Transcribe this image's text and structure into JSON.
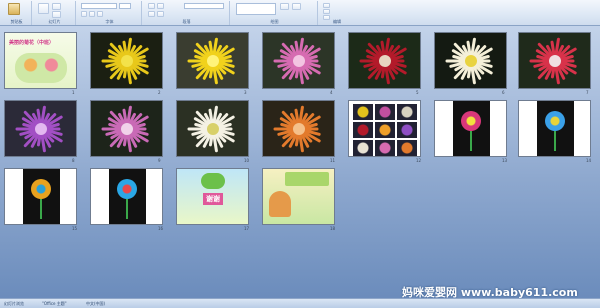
{
  "ribbon": {
    "groups": [
      {
        "label": "剪贴板"
      },
      {
        "label": "幻灯片"
      },
      {
        "label": "字体"
      },
      {
        "label": "段落"
      },
      {
        "label": "绘图"
      },
      {
        "label": "编辑"
      }
    ]
  },
  "slides": [
    {
      "num": "1",
      "kind": "title",
      "title": "美丽的菊花（中班）"
    },
    {
      "num": "2",
      "kind": "flower",
      "bg": "#1b1f12",
      "petal": "#e8c81a",
      "center": "#f3e24a"
    },
    {
      "num": "3",
      "kind": "flower",
      "bg": "#3a3d30",
      "petal": "#f1d21c",
      "center": "#fff37a"
    },
    {
      "num": "4",
      "kind": "flower",
      "bg": "#2c3527",
      "petal": "#d66bb1",
      "center": "#f3c4e2"
    },
    {
      "num": "5",
      "kind": "flower",
      "bg": "#1c2a18",
      "petal": "#b31a2a",
      "center": "#e7d6c0"
    },
    {
      "num": "6",
      "kind": "flower",
      "bg": "#141a12",
      "petal": "#f4efd8",
      "center": "#e9d340"
    },
    {
      "num": "7",
      "kind": "flower",
      "bg": "#1f2a1b",
      "petal": "#d8324a",
      "center": "#f0dfe2"
    },
    {
      "num": "8",
      "kind": "flower",
      "bg": "#2b2a38",
      "petal": "#a24fc4",
      "center": "#e3b8f0"
    },
    {
      "num": "9",
      "kind": "flower",
      "bg": "#1d241a",
      "petal": "#c96ab6",
      "center": "#f1d2ea"
    },
    {
      "num": "10",
      "kind": "flower",
      "bg": "#2b3023",
      "petal": "#f4f1e4",
      "center": "#d8d06a"
    },
    {
      "num": "11",
      "kind": "flower",
      "bg": "#2a2418",
      "petal": "#e37a2c",
      "center": "#f5c08a"
    },
    {
      "num": "12",
      "kind": "grid"
    },
    {
      "num": "13",
      "kind": "craft",
      "bg": "#111111",
      "petal": "#d9377a",
      "center": "#f2e23e"
    },
    {
      "num": "14",
      "kind": "craft",
      "bg": "#111111",
      "petal": "#3aa0e8",
      "center": "#e8d33a"
    },
    {
      "num": "15",
      "kind": "craft",
      "bg": "#111111",
      "petal": "#e8a21f",
      "center": "#2aa0d8"
    },
    {
      "num": "16",
      "kind": "craft",
      "bg": "#111111",
      "petal": "#2aa7e6",
      "center": "#e8494a"
    },
    {
      "num": "17",
      "kind": "thanks",
      "title": "谢谢"
    },
    {
      "num": "18",
      "kind": "cartoon"
    }
  ],
  "status": {
    "left": "幻灯片浏览",
    "theme": "\"Office 主题\"",
    "lang": "中文(中国)"
  },
  "watermark": "妈咪爱婴网 www.baby611.com"
}
